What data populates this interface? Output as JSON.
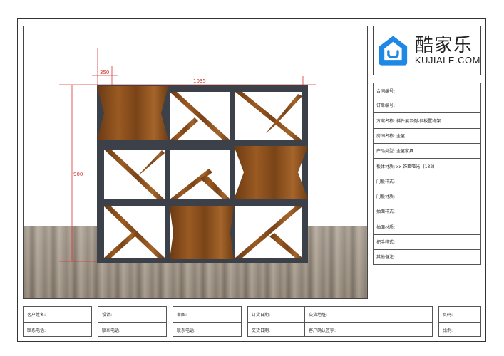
{
  "logo": {
    "icon": "kujiale-house-smile-icon",
    "name_cn": "酷家乐",
    "name_en": "KUJIALE.COM",
    "brand_color": "#1e88e5"
  },
  "dimensions": {
    "width_top": "350",
    "width_total": "1035",
    "height": "900"
  },
  "info": [
    {
      "label": "合同编号:",
      "value": ""
    },
    {
      "label": "订单编号:",
      "value": ""
    },
    {
      "label": "方案名称:",
      "value": "斜件展示例-斜板置物架"
    },
    {
      "label": "房间名称:",
      "value": "全屋"
    },
    {
      "label": "产品类型:",
      "value": "全屋家具"
    },
    {
      "label": "板体材质:",
      "value": "xx-饰面哑光- (132)"
    },
    {
      "label": "门板样式:",
      "value": ""
    },
    {
      "label": "门板材质:",
      "value": ""
    },
    {
      "label": "抽面样式:",
      "value": ""
    },
    {
      "label": "抽面材质:",
      "value": ""
    },
    {
      "label": "把手样式:",
      "value": ""
    },
    {
      "label": "其他备注:",
      "value": ""
    }
  ],
  "footer": {
    "customer_name": "客户姓名:",
    "customer_phone": "联系电话:",
    "designer": "设计:",
    "designer_phone": "联系电话:",
    "review": "审图:",
    "review_phone": "联系电话:",
    "order_date": "订货日期:",
    "delivery_date": "交货日期:",
    "delivery_address": "交货地址:",
    "customer_sign": "客户确认签字:",
    "page_no": "页码:",
    "scale": "比例:"
  }
}
